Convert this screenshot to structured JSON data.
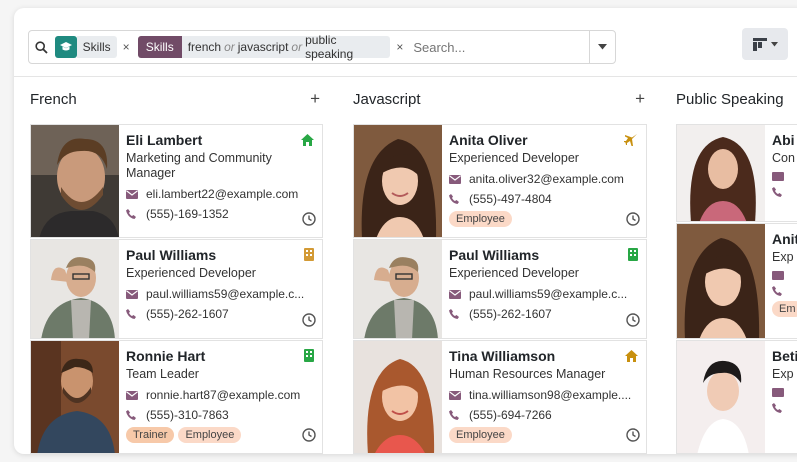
{
  "search": {
    "facet1_label": "Skills",
    "facet2_label": "Skills",
    "facet2_values": [
      "french",
      "javascript",
      "public speaking"
    ],
    "facet2_or": "or",
    "close_glyph": "×",
    "placeholder": "Search..."
  },
  "colors": {
    "facet_icon_bg": "#1f8a80",
    "facet_tag_bg": "#714b67",
    "home_icon": "#28a745",
    "plane_icon": "#c8900f",
    "badge_tag": "#fbd9c7"
  },
  "columns": [
    {
      "title": "French",
      "cards": [
        {
          "name": "Eli Lambert",
          "job": "Marketing and Community Manager",
          "email": "eli.lambert22@example.com",
          "phone": "(555)-169-1352",
          "tags": [],
          "status_icon": "home-icon"
        },
        {
          "name": "Paul Williams",
          "job": "Experienced Developer",
          "email": "paul.williams59@example.c...",
          "phone": "(555)-262-1607",
          "tags": [],
          "status_icon": "building-icon"
        },
        {
          "name": "Ronnie Hart",
          "job": "Team Leader",
          "email": "ronnie.hart87@example.com",
          "phone": "(555)-310-7863",
          "tags": [
            "Trainer",
            "Employee"
          ],
          "status_icon": "building-icon"
        }
      ]
    },
    {
      "title": "Javascript",
      "cards": [
        {
          "name": "Anita Oliver",
          "job": "Experienced Developer",
          "email": "anita.oliver32@example.com",
          "phone": "(555)-497-4804",
          "tags": [
            "Employee"
          ],
          "status_icon": "plane-icon"
        },
        {
          "name": "Paul Williams",
          "job": "Experienced Developer",
          "email": "paul.williams59@example.c...",
          "phone": "(555)-262-1607",
          "tags": [],
          "status_icon": "building-icon"
        },
        {
          "name": "Tina Williamson",
          "job": "Human Resources Manager",
          "email": "tina.williamson98@example....",
          "phone": "(555)-694-7266",
          "tags": [
            "Employee"
          ],
          "status_icon": "home-icon"
        }
      ]
    },
    {
      "title": "Public Speaking",
      "cards": [
        {
          "name": "Abi",
          "job": "Con"
        },
        {
          "name": "Anit",
          "job": "Exp"
        },
        {
          "name": "Beti",
          "job": "Exp"
        }
      ]
    }
  ],
  "col_plus": "+"
}
